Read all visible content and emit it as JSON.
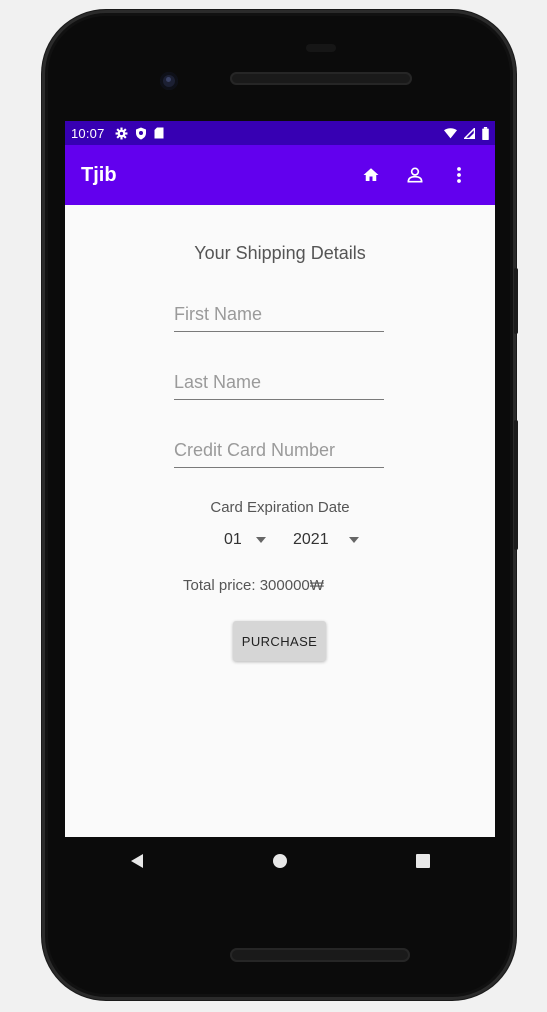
{
  "status_bar": {
    "time": "10:07",
    "left_icons": [
      "settings-icon",
      "shield-icon",
      "sd-card-icon"
    ],
    "right_icons": [
      "wifi-icon",
      "signal-icon",
      "battery-icon"
    ]
  },
  "app_bar": {
    "title": "Tjib",
    "actions": [
      "home-icon",
      "person-icon",
      "more-vert-icon"
    ],
    "color": "#6200ee",
    "status_color": "#3700b3"
  },
  "form": {
    "heading": "Your Shipping Details",
    "first_name": {
      "placeholder": "First Name",
      "value": ""
    },
    "last_name": {
      "placeholder": "Last Name",
      "value": ""
    },
    "card_number": {
      "placeholder": "Credit Card Number",
      "value": ""
    },
    "expiration_label": "Card Expiration Date",
    "month_selected": "01",
    "year_selected": "2021",
    "total_price": "Total price: 300000₩",
    "purchase_label": "PURCHASE"
  },
  "nav_bar": {
    "buttons": [
      "back-icon",
      "home-circle-icon",
      "recents-icon"
    ]
  }
}
